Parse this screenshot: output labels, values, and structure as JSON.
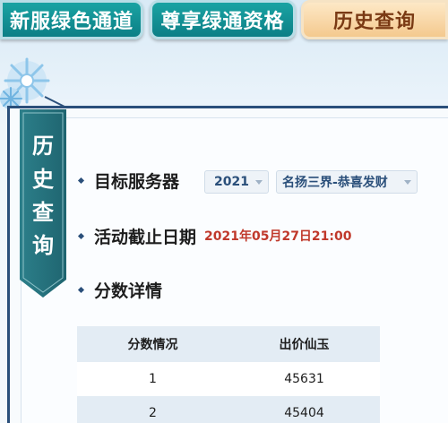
{
  "tabs": [
    {
      "label": "新服绿色通道",
      "active": false
    },
    {
      "label": "尊享绿通资格",
      "active": false
    },
    {
      "label": "历史查询",
      "active": true
    }
  ],
  "colors": {
    "tab_inactive": "#0c7f86",
    "tab_active": "#f4c98e",
    "accent": "#2a4f7a",
    "date_value": "#c0392b"
  },
  "sidebar_ribbon": {
    "chars": [
      "历",
      "史",
      "查",
      "询"
    ]
  },
  "fields": {
    "server": {
      "label": "目标服务器",
      "year": "2021",
      "server_name": "名扬三界-恭喜发财"
    },
    "deadline": {
      "label": "活动截止日期",
      "value": "2021年05月27日21:00"
    },
    "score": {
      "label": "分数详情"
    }
  },
  "score_table": {
    "headers": [
      "分数情况",
      "出价仙玉"
    ],
    "rows": [
      [
        "1",
        "45631"
      ],
      [
        "2",
        "45404"
      ]
    ]
  }
}
